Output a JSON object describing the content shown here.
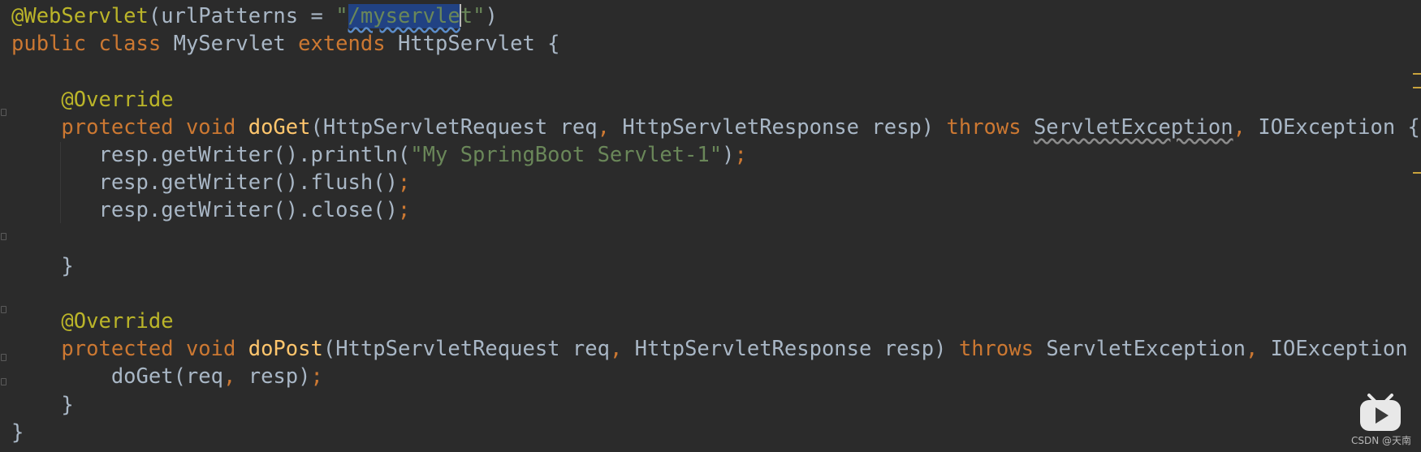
{
  "editor": {
    "lines": [
      {
        "id": "l1",
        "tokens": [
          {
            "c": "ann",
            "t": "@WebServlet"
          },
          {
            "c": "param",
            "t": "(urlPatterns = "
          },
          {
            "c": "str",
            "t": "\""
          },
          {
            "c": "str sel",
            "t": "/myservle"
          },
          {
            "c": "caret",
            "t": ""
          },
          {
            "c": "str",
            "t": "t"
          },
          {
            "c": "str",
            "t": "\""
          },
          {
            "c": "param",
            "t": ")"
          }
        ]
      },
      {
        "id": "l2",
        "tokens": [
          {
            "c": "kw",
            "t": "public class "
          },
          {
            "c": "param",
            "t": "MyServlet "
          },
          {
            "c": "kw",
            "t": "extends "
          },
          {
            "c": "param",
            "t": "HttpServlet {"
          }
        ]
      },
      {
        "id": "l3",
        "tokens": []
      },
      {
        "id": "l4",
        "tokens": [
          {
            "c": "param",
            "t": "    "
          },
          {
            "c": "ann",
            "t": "@Override"
          }
        ]
      },
      {
        "id": "l5",
        "tokens": [
          {
            "c": "param",
            "t": "    "
          },
          {
            "c": "kw",
            "t": "protected void "
          },
          {
            "c": "fn",
            "t": "doGet"
          },
          {
            "c": "param",
            "t": "(HttpServletRequest req"
          },
          {
            "c": "kw",
            "t": ", "
          },
          {
            "c": "param",
            "t": "HttpServletResponse resp) "
          },
          {
            "c": "kw",
            "t": "throws "
          },
          {
            "c": "warn",
            "t": "ServletException"
          },
          {
            "c": "kw",
            "t": ", "
          },
          {
            "c": "param",
            "t": "IOException {"
          }
        ]
      },
      {
        "id": "l6",
        "tokens": [
          {
            "c": "param",
            "t": "       resp.getWriter().println("
          },
          {
            "c": "str",
            "t": "\"My SpringBoot Servlet-1\""
          },
          {
            "c": "param",
            "t": ")"
          },
          {
            "c": "kw",
            "t": ";"
          }
        ]
      },
      {
        "id": "l7",
        "tokens": [
          {
            "c": "param",
            "t": "       resp.getWriter().flush()"
          },
          {
            "c": "kw",
            "t": ";"
          }
        ]
      },
      {
        "id": "l8",
        "tokens": [
          {
            "c": "param",
            "t": "       resp.getWriter().close()"
          },
          {
            "c": "kw",
            "t": ";"
          }
        ]
      },
      {
        "id": "l9",
        "tokens": []
      },
      {
        "id": "l10",
        "tokens": [
          {
            "c": "param",
            "t": "    }"
          }
        ]
      },
      {
        "id": "l11",
        "tokens": []
      },
      {
        "id": "l12",
        "tokens": [
          {
            "c": "param",
            "t": "    "
          },
          {
            "c": "ann",
            "t": "@Override"
          }
        ]
      },
      {
        "id": "l13",
        "tokens": [
          {
            "c": "param",
            "t": "    "
          },
          {
            "c": "kw",
            "t": "protected void "
          },
          {
            "c": "fn",
            "t": "doPost"
          },
          {
            "c": "param",
            "t": "(HttpServletRequest req"
          },
          {
            "c": "kw",
            "t": ", "
          },
          {
            "c": "param",
            "t": "HttpServletResponse resp) "
          },
          {
            "c": "kw",
            "t": "throws "
          },
          {
            "c": "param",
            "t": "ServletException"
          },
          {
            "c": "kw",
            "t": ", "
          },
          {
            "c": "param",
            "t": "IOException {"
          }
        ]
      },
      {
        "id": "l14",
        "tokens": [
          {
            "c": "param",
            "t": "        doGet(req"
          },
          {
            "c": "kw",
            "t": ", "
          },
          {
            "c": "param",
            "t": "resp)"
          },
          {
            "c": "kw",
            "t": ";"
          }
        ]
      },
      {
        "id": "l15",
        "tokens": [
          {
            "c": "param",
            "t": "    }"
          }
        ]
      },
      {
        "id": "l16",
        "tokens": [
          {
            "c": "param",
            "t": "}"
          }
        ]
      }
    ]
  },
  "colors": {
    "background": "#2b2b2b",
    "keyword": "#cc7832",
    "annotation": "#bbb529",
    "method": "#ffc66d",
    "string": "#6a8759",
    "text": "#a9b7c6",
    "selection": "#214283"
  },
  "watermark": {
    "text": "CSDN @天南"
  },
  "logo": {
    "icon": "bilibili-play-logo"
  }
}
